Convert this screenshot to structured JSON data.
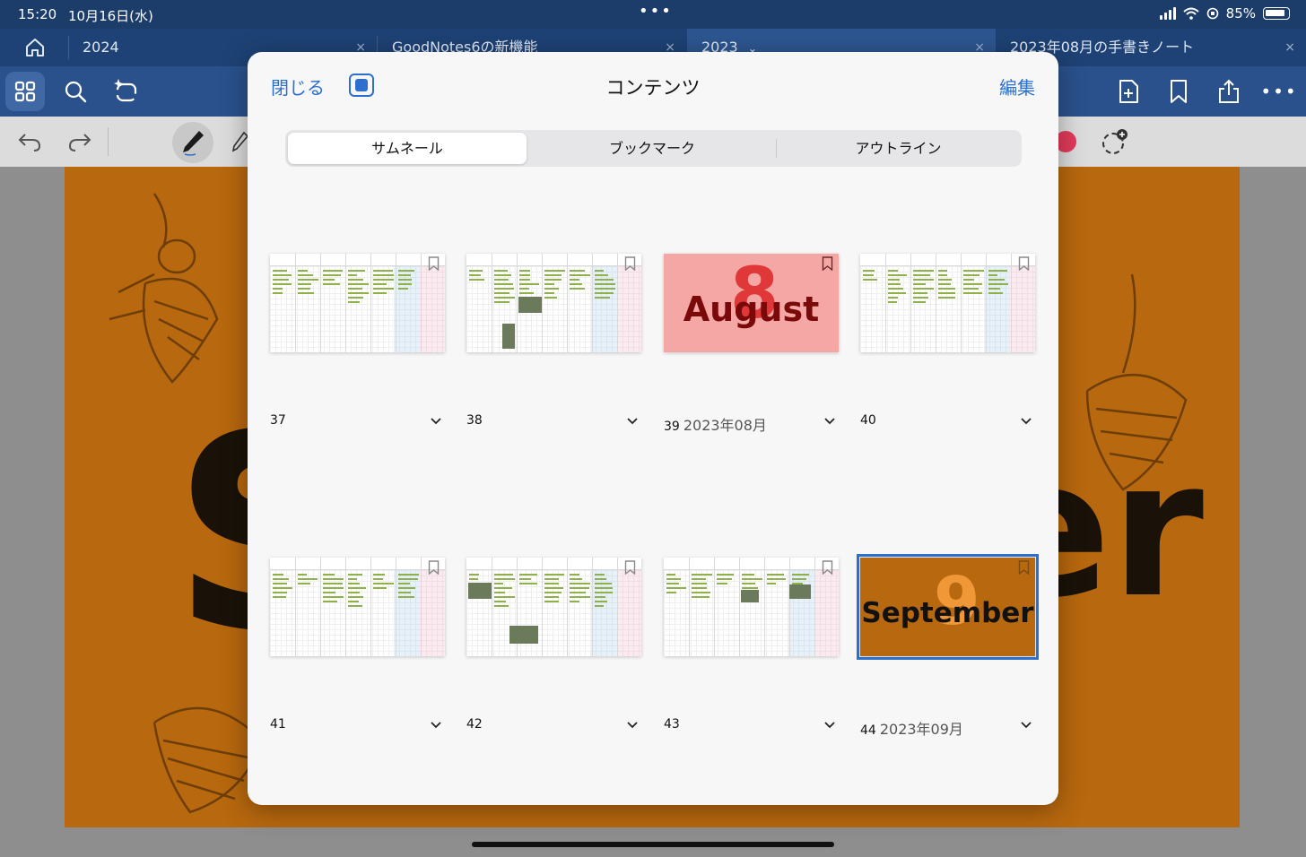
{
  "status_bar": {
    "time": "15:20",
    "date": "10月16日(水)",
    "battery": "85%"
  },
  "tabs": [
    {
      "label": "2024",
      "close": "×"
    },
    {
      "label": "GoodNotes6の新機能",
      "close": "×"
    },
    {
      "label": "2023",
      "close": "×"
    },
    {
      "label": "2023年08月の手書きノート",
      "close": "×"
    }
  ],
  "modal": {
    "close_label": "閉じる",
    "title": "コンテンツ",
    "edit_label": "編集",
    "segments": [
      "サムネール",
      "ブックマーク",
      "アウトライン"
    ]
  },
  "thumbnails": [
    {
      "number": "37",
      "subtitle": ""
    },
    {
      "number": "38",
      "subtitle": ""
    },
    {
      "number": "39",
      "subtitle": "2023年08月",
      "cover_number": "8",
      "cover_word": "August"
    },
    {
      "number": "40",
      "subtitle": ""
    },
    {
      "number": "41",
      "subtitle": ""
    },
    {
      "number": "42",
      "subtitle": ""
    },
    {
      "number": "43",
      "subtitle": ""
    },
    {
      "number": "44",
      "subtitle": "2023年09月",
      "cover_number": "9",
      "cover_word": "September"
    }
  ],
  "background_page": {
    "left_letter": "S",
    "right_letters": "er"
  },
  "colors": {
    "accent": "#2c6fcf",
    "toolbar": "#2a518c",
    "page_orange": "#b8680e",
    "red_pen": "#e23a5c"
  }
}
